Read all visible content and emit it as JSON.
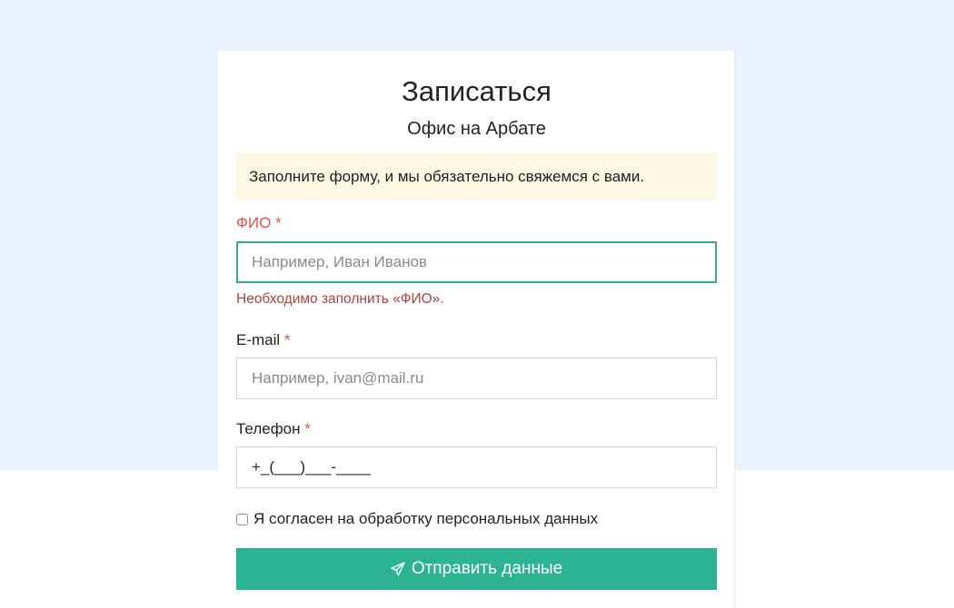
{
  "form": {
    "title": "Записаться",
    "subtitle": "Офис на Арбате",
    "notice": "Заполните форму, и мы обязательно свяжемся с вами.",
    "required_mark": "*",
    "fields": {
      "name": {
        "label": "ФИО",
        "placeholder": "Например, Иван Иванов",
        "value": "",
        "error": "Необходимо заполнить «ФИО»."
      },
      "email": {
        "label": "E-mail",
        "placeholder": "Например, ivan@mail.ru",
        "value": ""
      },
      "phone": {
        "label": "Телефон",
        "placeholder": "",
        "value": "+_(___)___-____"
      }
    },
    "consent": {
      "label": "Я согласен на обработку персональных данных",
      "checked": false
    },
    "submit": {
      "label": "Отправить данные",
      "icon": "paper-plane-icon"
    }
  },
  "colors": {
    "page_background_top": "#eaf2fe",
    "notice_background": "#fcf8e3",
    "error_label": "#d9534f",
    "error_message": "#a94442",
    "focus_border": "#39a987",
    "button": "#2bb393"
  }
}
